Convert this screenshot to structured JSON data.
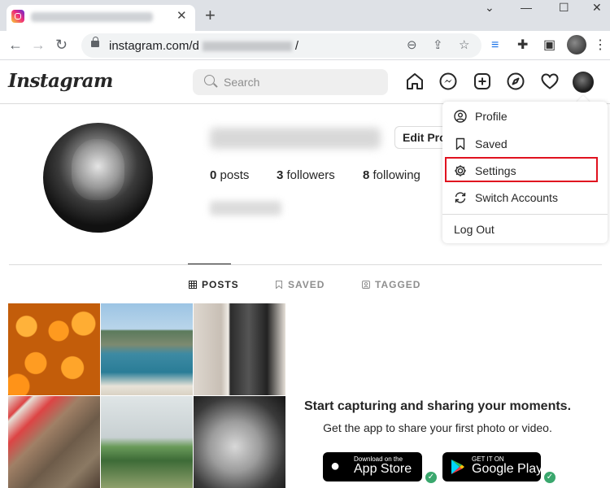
{
  "browser": {
    "url_prefix": "instagram.com/d",
    "url_suffix": "/",
    "tab_close": "✕",
    "new_tab": "+",
    "window_controls": [
      "⌄",
      "—",
      "☐",
      "✕"
    ]
  },
  "header": {
    "logo": "Instagram",
    "search_placeholder": "Search"
  },
  "profile": {
    "edit_label": "Edit Prof",
    "stats": [
      {
        "value": "0",
        "label": "posts"
      },
      {
        "value": "3",
        "label": "followers"
      },
      {
        "value": "8",
        "label": "following"
      }
    ]
  },
  "tabs": [
    {
      "label": "POSTS",
      "icon": "grid-icon",
      "active": true
    },
    {
      "label": "SAVED",
      "icon": "bookmark-icon",
      "active": false
    },
    {
      "label": "TAGGED",
      "icon": "tagged-icon",
      "active": false
    }
  ],
  "cta": {
    "title": "Start capturing and sharing your moments.",
    "subtitle": "Get the app to share your first photo or video.",
    "appstore_small": "Download on the",
    "appstore_big": "App Store",
    "googleplay_small": "GET IT ON",
    "googleplay_big": "Google Play"
  },
  "menu": {
    "items": [
      {
        "label": "Profile",
        "icon": "profile-icon"
      },
      {
        "label": "Saved",
        "icon": "bookmark-icon"
      },
      {
        "label": "Settings",
        "icon": "gear-icon"
      },
      {
        "label": "Switch Accounts",
        "icon": "switch-icon"
      }
    ],
    "logout": "Log Out"
  },
  "colors": {
    "highlight": "#e0121f",
    "text": "#262626",
    "muted": "#8e8e8e"
  }
}
